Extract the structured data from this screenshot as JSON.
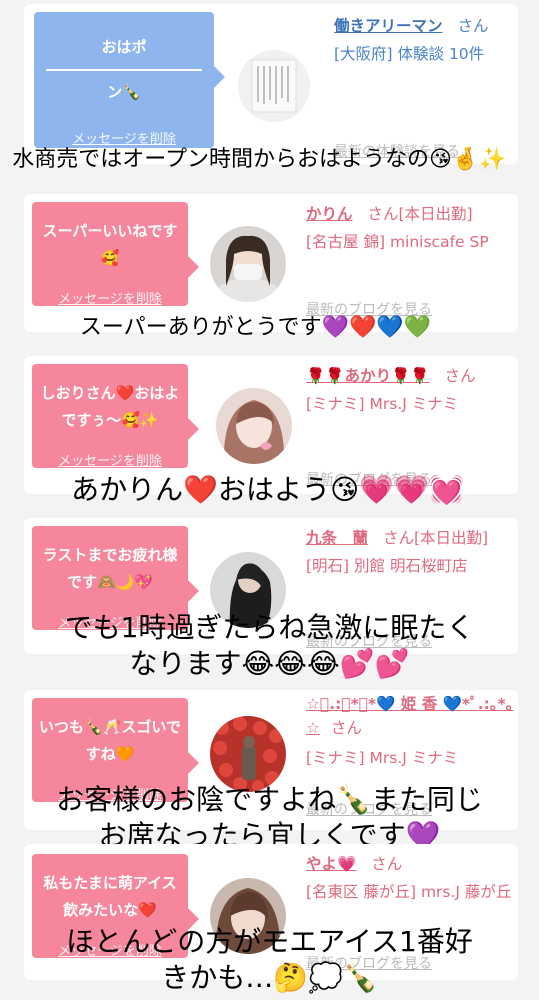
{
  "posts": [
    {
      "message": "おはポン🍾",
      "delete_label": "メッセージを削除",
      "name": "働きアリーマン",
      "suffix": "さん",
      "area": "[大阪府] 体験談 10件",
      "blog": "最新の体験談を見る",
      "bubble_color": "#8fb5ef",
      "caption": "水商売ではオープン時間からおはようなの😘🤞✨"
    },
    {
      "message": "スーパーいいねです🥰",
      "delete_label": "メッセージを削除",
      "name": "かりん",
      "suffix": "さん[本日出勤]",
      "area": "[名古屋 錦] miniscafe SP",
      "blog": "最新のブログを見る",
      "bubble_color": "#f6869b",
      "caption": "スーパーありがとうです💜❤️💙💚"
    },
    {
      "message": "しおりさん❤️おはよですぅ〜🥰✨",
      "delete_label": "メッセージを削除",
      "name": "🌹🌹あかり🌹🌹",
      "suffix": "さん",
      "area": "[ミナミ] Mrs.J ミナミ",
      "blog": "最新のブログを見る",
      "bubble_color": "#f6869b",
      "caption": "あかりん❤️おはよう😘💗💗💓"
    },
    {
      "message": "ラストまでお疲れ様です🙈🌙💖",
      "delete_label": "メッセージを削除",
      "name": "九条　蘭",
      "suffix": "さん[本日出勤]",
      "area": "[明石] 別館 明石桜町店",
      "blog": "最新のブログを見る",
      "bubble_color": "#f6869b",
      "caption_line1": "でも1時過ぎたらね急激に眠たく",
      "caption_line2": "なります😂😂😂💕💕"
    },
    {
      "message": "いつも🍾🥂スゴいですね🧡",
      "delete_label": "メッセージを削除",
      "name": "☆ﾟ.:｡*｡*💙 姫 香 💙*ﾟ.:｡*｡☆",
      "suffix": "さん",
      "area": "[ミナミ] Mrs.J ミナミ",
      "blog": "最新のブログを見る",
      "bubble_color": "#f6869b",
      "caption_line1": "お客様のお陰ですよね🍾また同じ",
      "caption_line2": "お席なったら宜しくです💜"
    },
    {
      "message": "私もたまに萌アイス飲みたいな❤️",
      "delete_label": "メッセージを削除",
      "name": "やよ💗",
      "suffix": "さん",
      "area": "[名東区 藤が丘] mrs.J 藤が丘",
      "blog": "最新のブログを見る",
      "bubble_color": "#f6869b",
      "caption_line1": "ほとんどの方がモエアイス1番好",
      "caption_line2": "きかも…🤔💭🍾"
    }
  ]
}
